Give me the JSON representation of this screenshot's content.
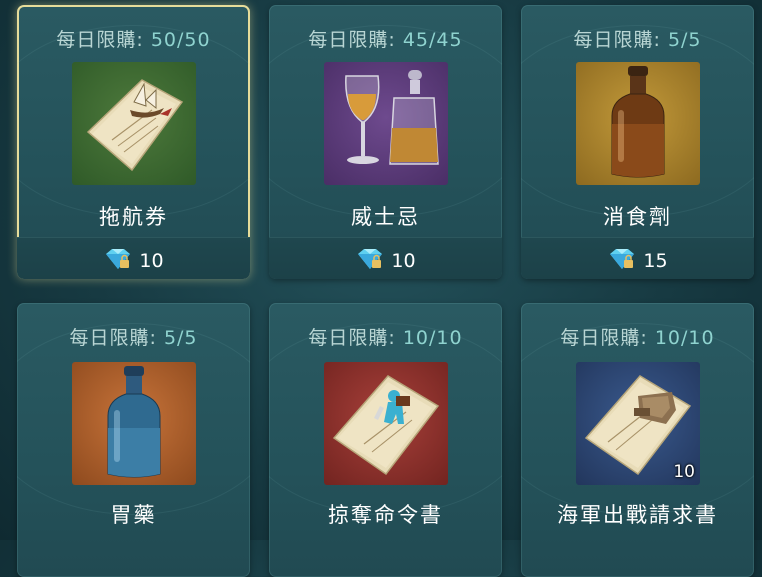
{
  "limit_label": "每日限購:",
  "items": [
    {
      "limit": "50/50",
      "name": "拖航券",
      "price": "10",
      "selected": true,
      "icon": "tow-ticket-icon"
    },
    {
      "limit": "45/45",
      "name": "威士忌",
      "price": "10",
      "icon": "whiskey-icon"
    },
    {
      "limit": "5/5",
      "name": "消食劑",
      "price": "15",
      "icon": "digestive-bottle-icon"
    },
    {
      "limit": "5/5",
      "name": "胃藥",
      "price": "",
      "icon": "stomach-medicine-bottle-icon"
    },
    {
      "limit": "10/10",
      "name": "掠奪命令書",
      "price": "",
      "icon": "plunder-order-icon"
    },
    {
      "limit": "10/10",
      "name": "海軍出戰請求書",
      "price": "",
      "quantity": "10",
      "icon": "navy-request-icon"
    }
  ],
  "colors": {
    "accent": "#8fd3cf",
    "selected_border": "#e6dc9a",
    "gem": "#5fd0f0"
  }
}
